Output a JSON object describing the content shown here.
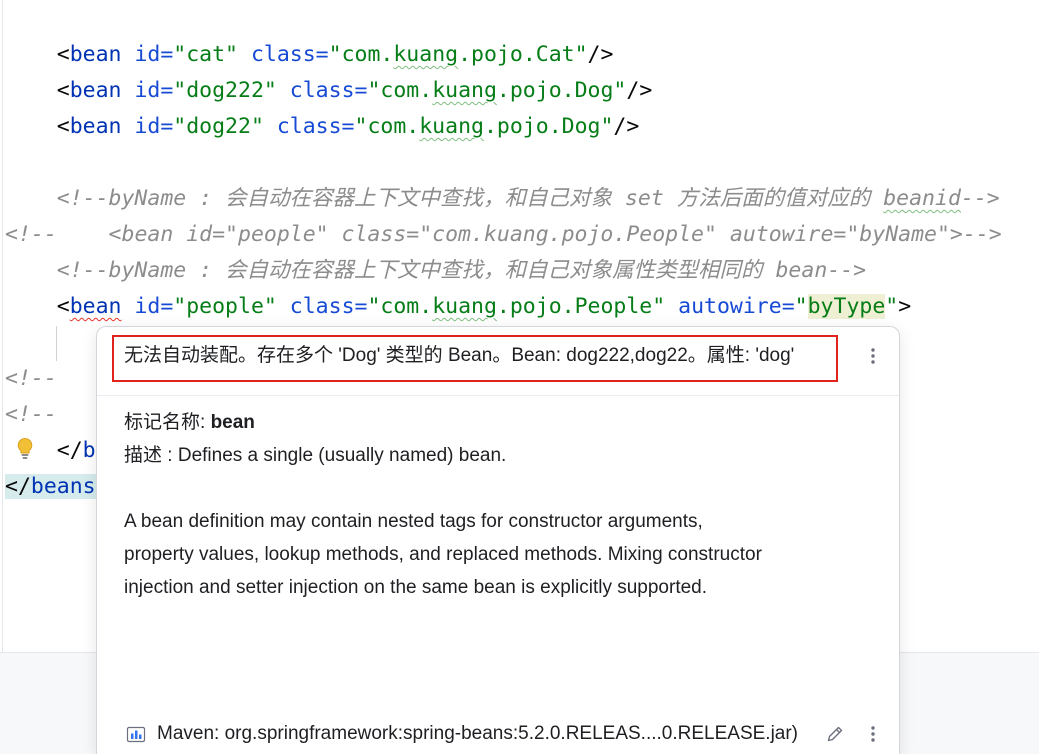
{
  "colors": {
    "tag": "#0033b3",
    "attribute": "#174ad4",
    "value": "#067d17",
    "comment": "#8c8c8c",
    "text": "#080808",
    "error_underline": "#e5312b",
    "typo_underline": "#7fbf7f",
    "annotation_frame": "#e0241b",
    "usage_highlight": "#efefd3",
    "match_highlight": "#d6ecec"
  },
  "editor": {
    "lines": [
      [
        "<",
        "bean",
        " id=",
        "\"cat\"",
        " class=",
        "\"com.",
        "kuang",
        ".pojo.Cat\"",
        "/>"
      ],
      [
        "<",
        "bean",
        " id=",
        "\"dog222\"",
        " class=",
        "\"com.",
        "kuang",
        ".pojo.Dog\"",
        "/>"
      ],
      [
        "<",
        "bean",
        " id=",
        "\"dog22\"",
        " class=",
        "\"com.",
        "kuang",
        ".pojo.Dog\"",
        "/>"
      ],
      [],
      [
        "<!--byName : 会自动在容器上下文中查找，和自己对象 set 方法后面的值对应的 ",
        "beanid",
        "-->"
      ],
      [
        "<!--    <bean id=\"people\" class=\"com.kuang.pojo.People\" autowire=\"byName\">-->"
      ],
      [
        "<!--byName : 会自动在容器上下文中查找，和自己对象属性类型相同的 bean-->"
      ],
      [
        "<",
        "bean",
        " id=",
        "\"people\"",
        " class=",
        "\"com.",
        "kuang",
        ".pojo.People\"",
        " autowire=",
        "\"",
        "byType",
        "\"",
        ">"
      ],
      [],
      [
        "<!--"
      ],
      [
        "<!--"
      ],
      [
        "</",
        "b"
      ],
      [
        "</",
        "beans"
      ]
    ],
    "gutter_icon": "lightbulb-icon"
  },
  "popup": {
    "error_message": "无法自动装配。存在多个 'Dog' 类型的 Bean。Bean: dog222,dog22。属性: 'dog'",
    "tag_name": {
      "label": "标记名称: ",
      "value": "bean"
    },
    "description": {
      "label": "描述 : ",
      "value": "Defines a single (usually named) bean."
    },
    "details": [
      "A bean definition may contain nested tags for constructor arguments,",
      "property values, lookup methods, and replaced methods. Mixing constructor",
      "injection and setter injection on the same bean is explicitly supported."
    ],
    "source": "Maven: org.springframework:spring-beans:5.2.0.RELEAS....0.RELEASE.jar)",
    "icons": {
      "more_actions": "more-vertical-icon",
      "library": "library-icon",
      "edit": "pencil-icon"
    }
  }
}
